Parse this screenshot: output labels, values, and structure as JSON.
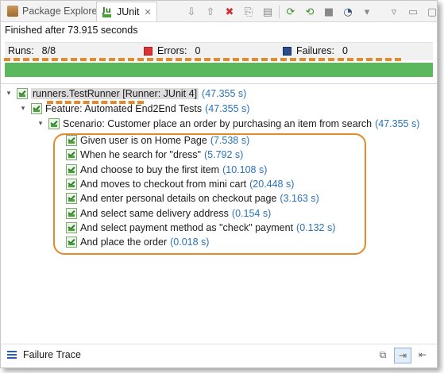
{
  "tabs": [
    {
      "label": "Package Explorer",
      "icon": "package-icon"
    },
    {
      "label": "JUnit",
      "icon": "junit-icon",
      "active": true
    }
  ],
  "status": {
    "finished_text": "Finished after 73.915 seconds"
  },
  "counters": {
    "runs_label": "Runs:",
    "runs_value": "8/8",
    "errors_label": "Errors:",
    "errors_value": "0",
    "failures_label": "Failures:",
    "failures_value": "0"
  },
  "progress": {
    "fraction": 1.0,
    "color": "#5cb85c"
  },
  "tree": {
    "runner": {
      "label": "runners.TestRunner [Runner: JUnit 4]",
      "time": "(47.355 s)"
    },
    "feature": {
      "label": "Feature: Automated End2End Tests",
      "time": "(47.355 s)"
    },
    "scenario": {
      "label": "Scenario: Customer place an order by purchasing an item from search",
      "time": "(47.355 s)"
    },
    "steps": [
      {
        "label": "Given user is on Home Page",
        "time": "(7.538 s)"
      },
      {
        "label": "When he search for \"dress\"",
        "time": "(5.792 s)"
      },
      {
        "label": "And choose to buy the first item",
        "time": "(10.108 s)"
      },
      {
        "label": "And moves to checkout from mini cart",
        "time": "(20.448 s)"
      },
      {
        "label": "And enter personal details on checkout page",
        "time": "(3.163 s)"
      },
      {
        "label": "And select same delivery address",
        "time": "(0.154 s)"
      },
      {
        "label": "And select payment method as \"check\" payment",
        "time": "(0.132 s)"
      },
      {
        "label": "And place the order",
        "time": "(0.018 s)"
      }
    ]
  },
  "bottom": {
    "failure_trace_label": "Failure Trace"
  },
  "colors": {
    "accent_orange": "#e58a2a",
    "time_blue": "#2a73b8"
  }
}
